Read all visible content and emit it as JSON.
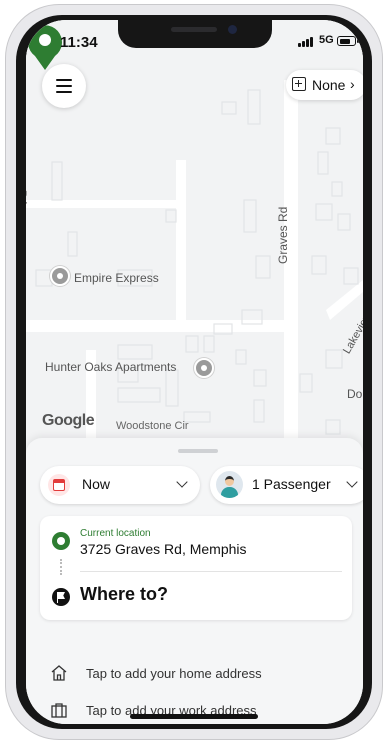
{
  "status_bar": {
    "time": "11:34",
    "network": "5G"
  },
  "map": {
    "filter_button": {
      "label": "None",
      "chevron": "›"
    },
    "poi_labels": {
      "empire": "Empire Express",
      "hunter": "Hunter Oaks Apartments"
    },
    "street_labels": {
      "graves": "Graves Rd",
      "woodstone": "Woodstone Cir",
      "lakeview": "Lakeview",
      "dol": "Dol",
      "rd_left": "Rd"
    },
    "attribution": "Google"
  },
  "sheet": {
    "time_chip": {
      "label": "Now"
    },
    "passenger_chip": {
      "label": "1 Passenger"
    },
    "pickup": {
      "label": "Current location",
      "address": "3725 Graves Rd, Memphis"
    },
    "destination_prompt": "Where to?",
    "shortcuts": {
      "home": "Tap to add your home address",
      "work": "Tap to add your work address"
    }
  },
  "colors": {
    "brand_green": "#2e7d32",
    "calendar_red": "#e23b3b"
  },
  "icons": [
    "menu-icon",
    "add-box-icon",
    "chevron-right-icon",
    "location-pin-icon",
    "calendar-icon",
    "passenger-avatar-icon",
    "chevron-down-icon",
    "flag-icon",
    "home-icon",
    "briefcase-icon"
  ]
}
